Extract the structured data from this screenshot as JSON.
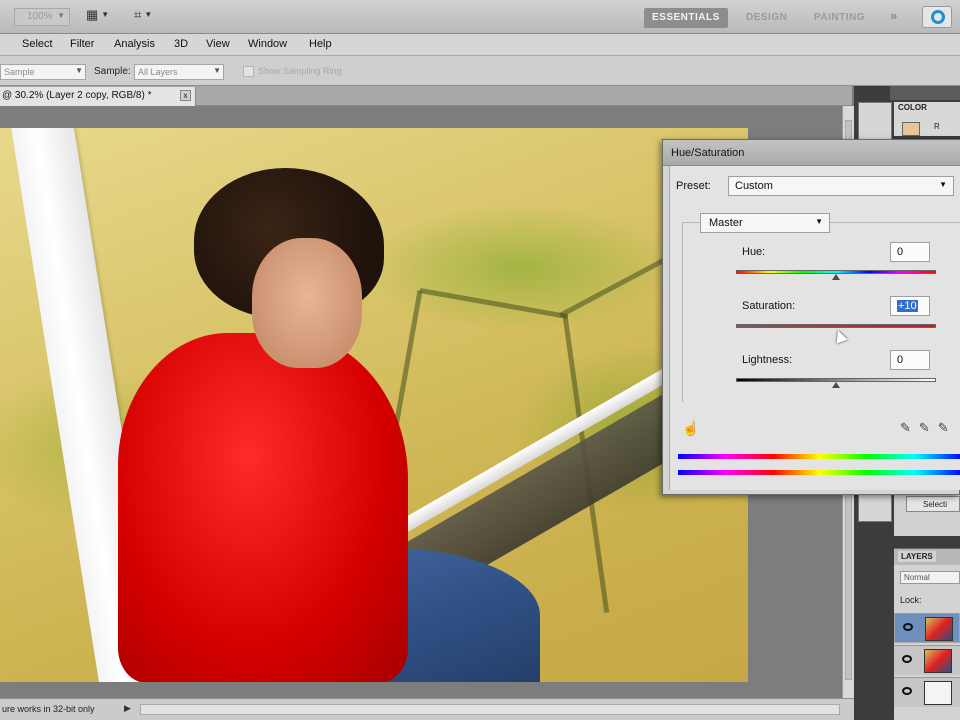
{
  "appbar": {
    "zoom_value": "100%",
    "workspaces": [
      "ESSENTIALS",
      "DESIGN",
      "PAINTING"
    ],
    "active_workspace": "ESSENTIALS",
    "more_label": "»",
    "accent": "#1e8fcf"
  },
  "menubar": {
    "items": [
      "Select",
      "Filter",
      "Analysis",
      "3D",
      "View",
      "Window",
      "Help"
    ]
  },
  "options": {
    "sample_size_value": "Sample",
    "sample_label": "Sample:",
    "sample_value": "All Layers",
    "sample_ring_label": "Show Sampling Ring"
  },
  "document": {
    "tab_title": "@ 30.2% (Layer 2 copy, RGB/8) *",
    "close_label": "x"
  },
  "statusbar": {
    "message": "ure works in 32-bit only",
    "nav_label": "▶"
  },
  "panels": {
    "color_tab": "COLOR",
    "color_channel": "R",
    "selection_label": "Selecti",
    "layers_tab": "LAYERS",
    "blend_mode": "Normal",
    "lock_label": "Lock:"
  },
  "dialog": {
    "title": "Hue/Saturation",
    "preset_label": "Preset:",
    "preset_value": "Custom",
    "channel_value": "Master",
    "hue_label": "Hue:",
    "hue_value": "0",
    "saturation_label": "Saturation:",
    "saturation_value": "+10",
    "lightness_label": "Lightness:",
    "lightness_value": "0",
    "hue_level": 0.5,
    "saturation_level": 0.55,
    "lightness_level": 0.5
  }
}
